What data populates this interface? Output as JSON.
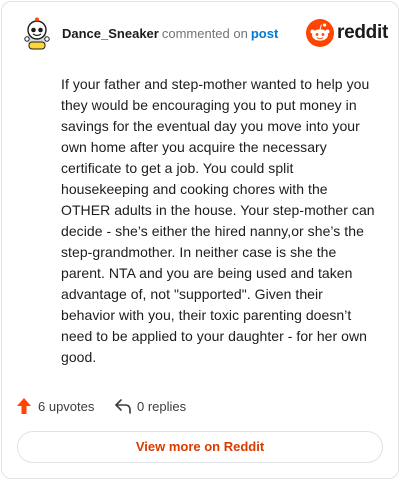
{
  "header": {
    "username": "Dance_Sneaker",
    "verb": "commented on",
    "post_link": "post",
    "brand_word": "reddit"
  },
  "comment": {
    "body": "If your father and step-mother wanted to help you they would be encouraging you to put money in savings for the eventual day you move into your own home after you acquire the necessary certificate to get a job. You could split housekeeping and cooking chores with the OTHER adults in the house. Your step-mother can decide - she’s either the hired nanny,or she’s the step-grandmother. In neither case is she the parent. NTA and you are being used and taken advantage of, not \"supported\". Given their behavior with you, their toxic parenting doesn’t need to be applied to your daughter - for her own good."
  },
  "actions": {
    "upvotes": "6 upvotes",
    "replies": "0 replies"
  },
  "footer": {
    "view_more": "View more on Reddit"
  },
  "colors": {
    "brand": "#ff4500",
    "link": "#0079d3",
    "button_text": "#d93a00"
  }
}
